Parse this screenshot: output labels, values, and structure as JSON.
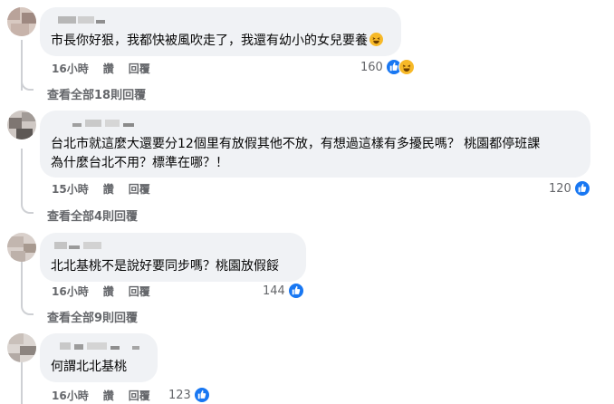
{
  "comments": [
    {
      "text": "市長你好狠，我都快被風吹走了，我還有幼小的女兒要養",
      "time": "16小時",
      "like_label": "讚",
      "reply_label": "回覆",
      "reaction_count": "160",
      "reactions": [
        "like-icon",
        "haha-icon"
      ],
      "view_replies": "查看全部18則回覆"
    },
    {
      "text_line1": "台北市就這麼大還要分12個里有放假其他不放，有想過這樣有多擾民嗎？ 桃園都停班課",
      "text_line2": "為什麼台北不用？標準在哪？！",
      "time": "15小時",
      "like_label": "讚",
      "reply_label": "回覆",
      "reaction_count": "120",
      "reactions": [
        "like-icon"
      ],
      "view_replies": "查看全部4則回覆"
    },
    {
      "text": "北北基桃不是說好要同步嗎？桃園放假餒",
      "time": "16小時",
      "like_label": "讚",
      "reply_label": "回覆",
      "reaction_count": "144",
      "reactions": [
        "like-icon"
      ],
      "view_replies": "查看全部9則回覆"
    },
    {
      "text": "何謂北北基桃",
      "time": "16小時",
      "like_label": "讚",
      "reply_label": "回覆",
      "reaction_count": "123",
      "reactions": [
        "like-icon"
      ]
    }
  ],
  "colors": {
    "bubble_bg": "#f0f2f5",
    "meta_text": "#65676b",
    "like_blue": "#1877f2",
    "haha_yellow": "#f7b928"
  }
}
